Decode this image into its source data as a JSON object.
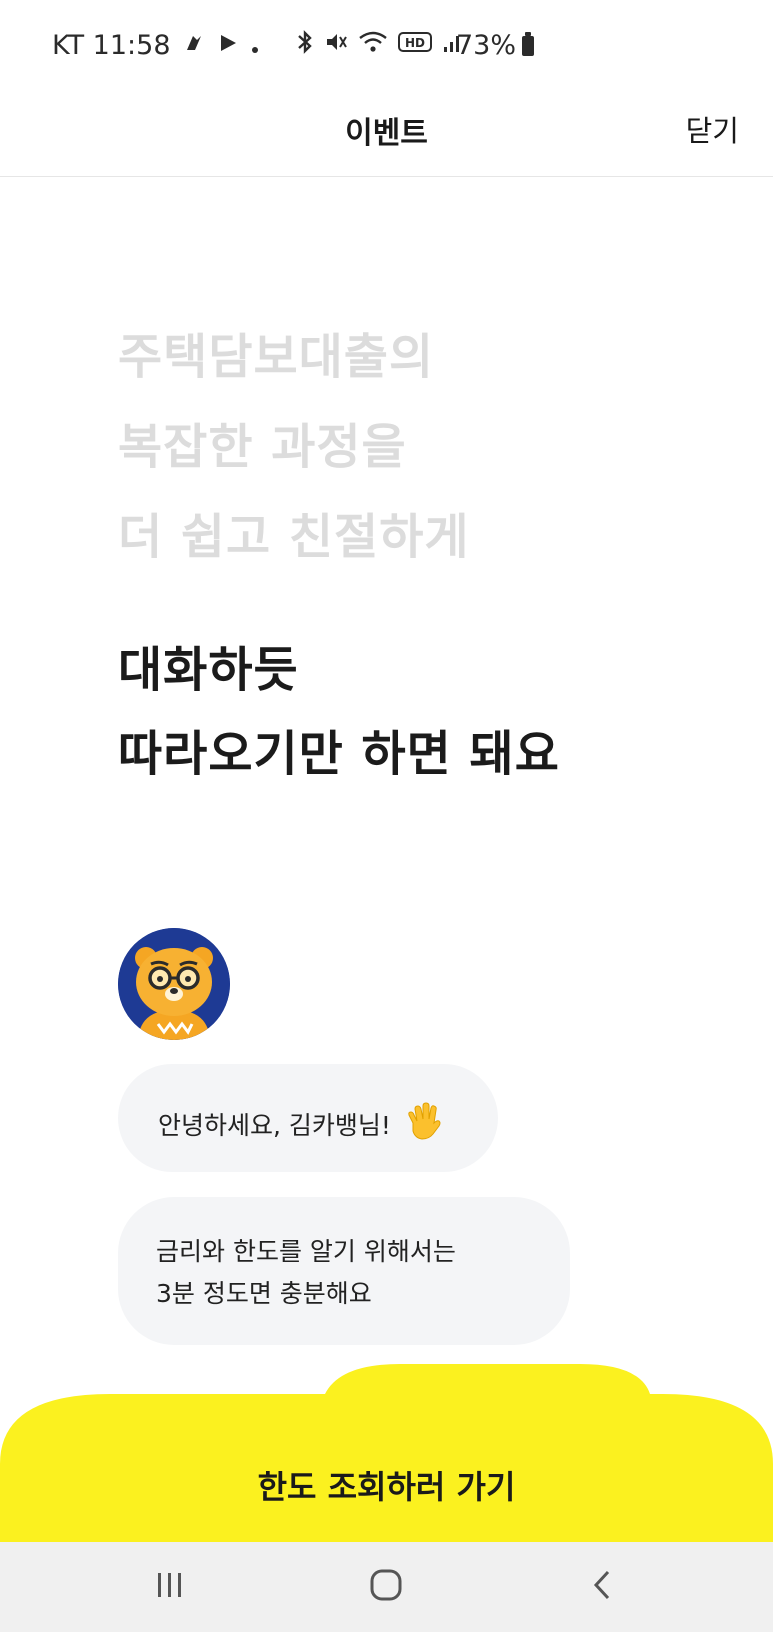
{
  "status_bar": {
    "carrier_time": "KT 11:58",
    "battery": "73%"
  },
  "header": {
    "title": "이벤트",
    "close_label": "닫기"
  },
  "hero": {
    "gray_lines": [
      "주택담보대출의",
      "복잡한 과정을",
      "더 쉽고 친절하게"
    ],
    "dark_lines": [
      "대화하듯",
      "따라오기만 하면 돼요"
    ]
  },
  "chat": {
    "greeting": "안녕하세요, 김카뱅님!",
    "message_lines": [
      "금리와 한도를 알기 위해서는",
      "3분 정도면 충분해요"
    ]
  },
  "cta": {
    "label": "한도 조회하러 가기"
  },
  "colors": {
    "accent_yellow": "#FBF11F",
    "avatar_bg": "#1E3A94",
    "hero_gray": "#DCDCDC",
    "bubble_bg": "#F4F5F7"
  },
  "icons": {
    "status": [
      "kakao-talk-icon",
      "play-store-icon",
      "dot-icon",
      "bluetooth-icon",
      "mute-icon",
      "wifi-icon",
      "hd-icon",
      "signal-icon",
      "battery-icon"
    ],
    "emoji": "waving-hand-icon",
    "nav": [
      "recent-apps-icon",
      "home-icon",
      "back-icon"
    ]
  }
}
